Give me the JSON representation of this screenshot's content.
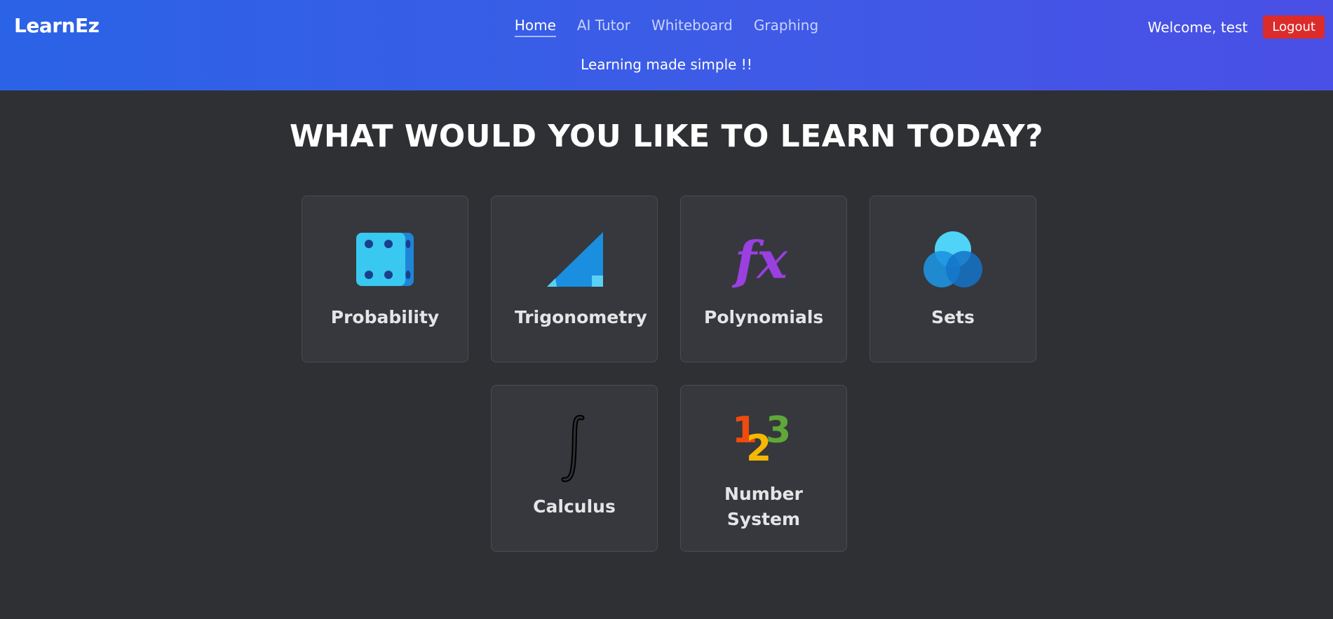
{
  "brand": "LearnEz",
  "nav": [
    "Home",
    "AI Tutor",
    "Whiteboard",
    "Graphing"
  ],
  "tagline": "Learning made simple !!",
  "user": {
    "welcome": "Welcome, test",
    "logout_label": "Logout"
  },
  "page_title": "WHAT WOULD YOU LIKE TO LEARN TODAY?",
  "topics": [
    {
      "label": "Probability",
      "icon": "dice-icon"
    },
    {
      "label": "Trigonometry",
      "icon": "triangle-icon"
    },
    {
      "label": "Polynomials",
      "icon": "function-fx-icon"
    },
    {
      "label": "Sets",
      "icon": "venn-diagram-icon"
    },
    {
      "label": "Calculus",
      "icon": "integral-icon"
    },
    {
      "label": "Number System",
      "icon": "numbers-123-icon"
    }
  ],
  "colors": {
    "header_start": "#2b63e6",
    "header_end": "#4a4fe6",
    "background": "#2f3034",
    "card": "#36383d",
    "logout": "#dc2b2b"
  }
}
